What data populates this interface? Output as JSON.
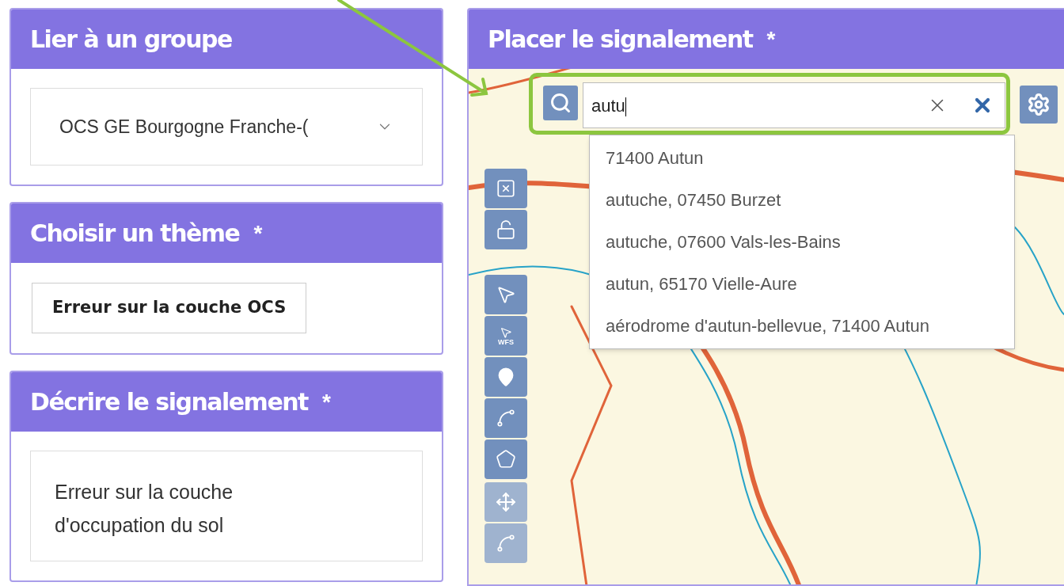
{
  "left_panels": [
    {
      "kind": "select",
      "title": "Lier à un groupe",
      "value": "OCS GE Bourgogne Franche-("
    },
    {
      "kind": "choice",
      "title": "Choisir un thème",
      "asterisk": "*",
      "value": "Erreur sur la couche OCS"
    },
    {
      "kind": "textarea",
      "title": "Décrire le signalement",
      "asterisk": "*",
      "value": "Erreur sur la couche d'occupation du sol"
    }
  ],
  "map_panel": {
    "title": "Placer le signalement",
    "asterisk": "*",
    "search": {
      "value": "autu",
      "highlighted": true
    },
    "suggestions": [
      "71400 Autun",
      "autuche, 07450 Burzet",
      "autuche, 07600 Vals-les-Bains",
      "autun, 65170 Vielle-Aure",
      "aérodrome d'autun-bellevue, 71400 Autun"
    ],
    "tool_groups": [
      {
        "tools": [
          {
            "kind": "zoom-extent",
            "active": false
          },
          {
            "kind": "unlock",
            "active": false
          }
        ]
      },
      {
        "tools": [
          {
            "kind": "select",
            "active": false
          },
          {
            "kind": "select-wfs",
            "active": false,
            "label": "WFS"
          },
          {
            "kind": "point",
            "active": false
          },
          {
            "kind": "line",
            "active": false
          },
          {
            "kind": "polygon",
            "active": false
          }
        ]
      },
      {
        "tools": [
          {
            "kind": "move",
            "active": false
          },
          {
            "kind": "edit",
            "active": false
          }
        ]
      }
    ]
  }
}
